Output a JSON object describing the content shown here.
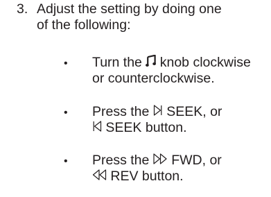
{
  "step": {
    "number": "3.",
    "text_line1": "Adjust the setting by doing one",
    "text_line2": "of the following:"
  },
  "items": [
    {
      "line1_pre": "Turn the ",
      "icon": "music-note-icon",
      "line1_post": " knob clockwise",
      "line2": "or counterclockwise."
    },
    {
      "line1_pre": "Press the ",
      "icon1": "seek-up-icon",
      "line1_post": " SEEK, or",
      "icon2": "seek-down-icon",
      "line2_post": " SEEK button."
    },
    {
      "line1_pre": "Press the ",
      "icon1": "fast-forward-icon",
      "line1_post": " FWD, or",
      "icon2": "rewind-icon",
      "line2_post": " REV button."
    }
  ],
  "bullet_char": "•",
  "text_color": "#231f20"
}
